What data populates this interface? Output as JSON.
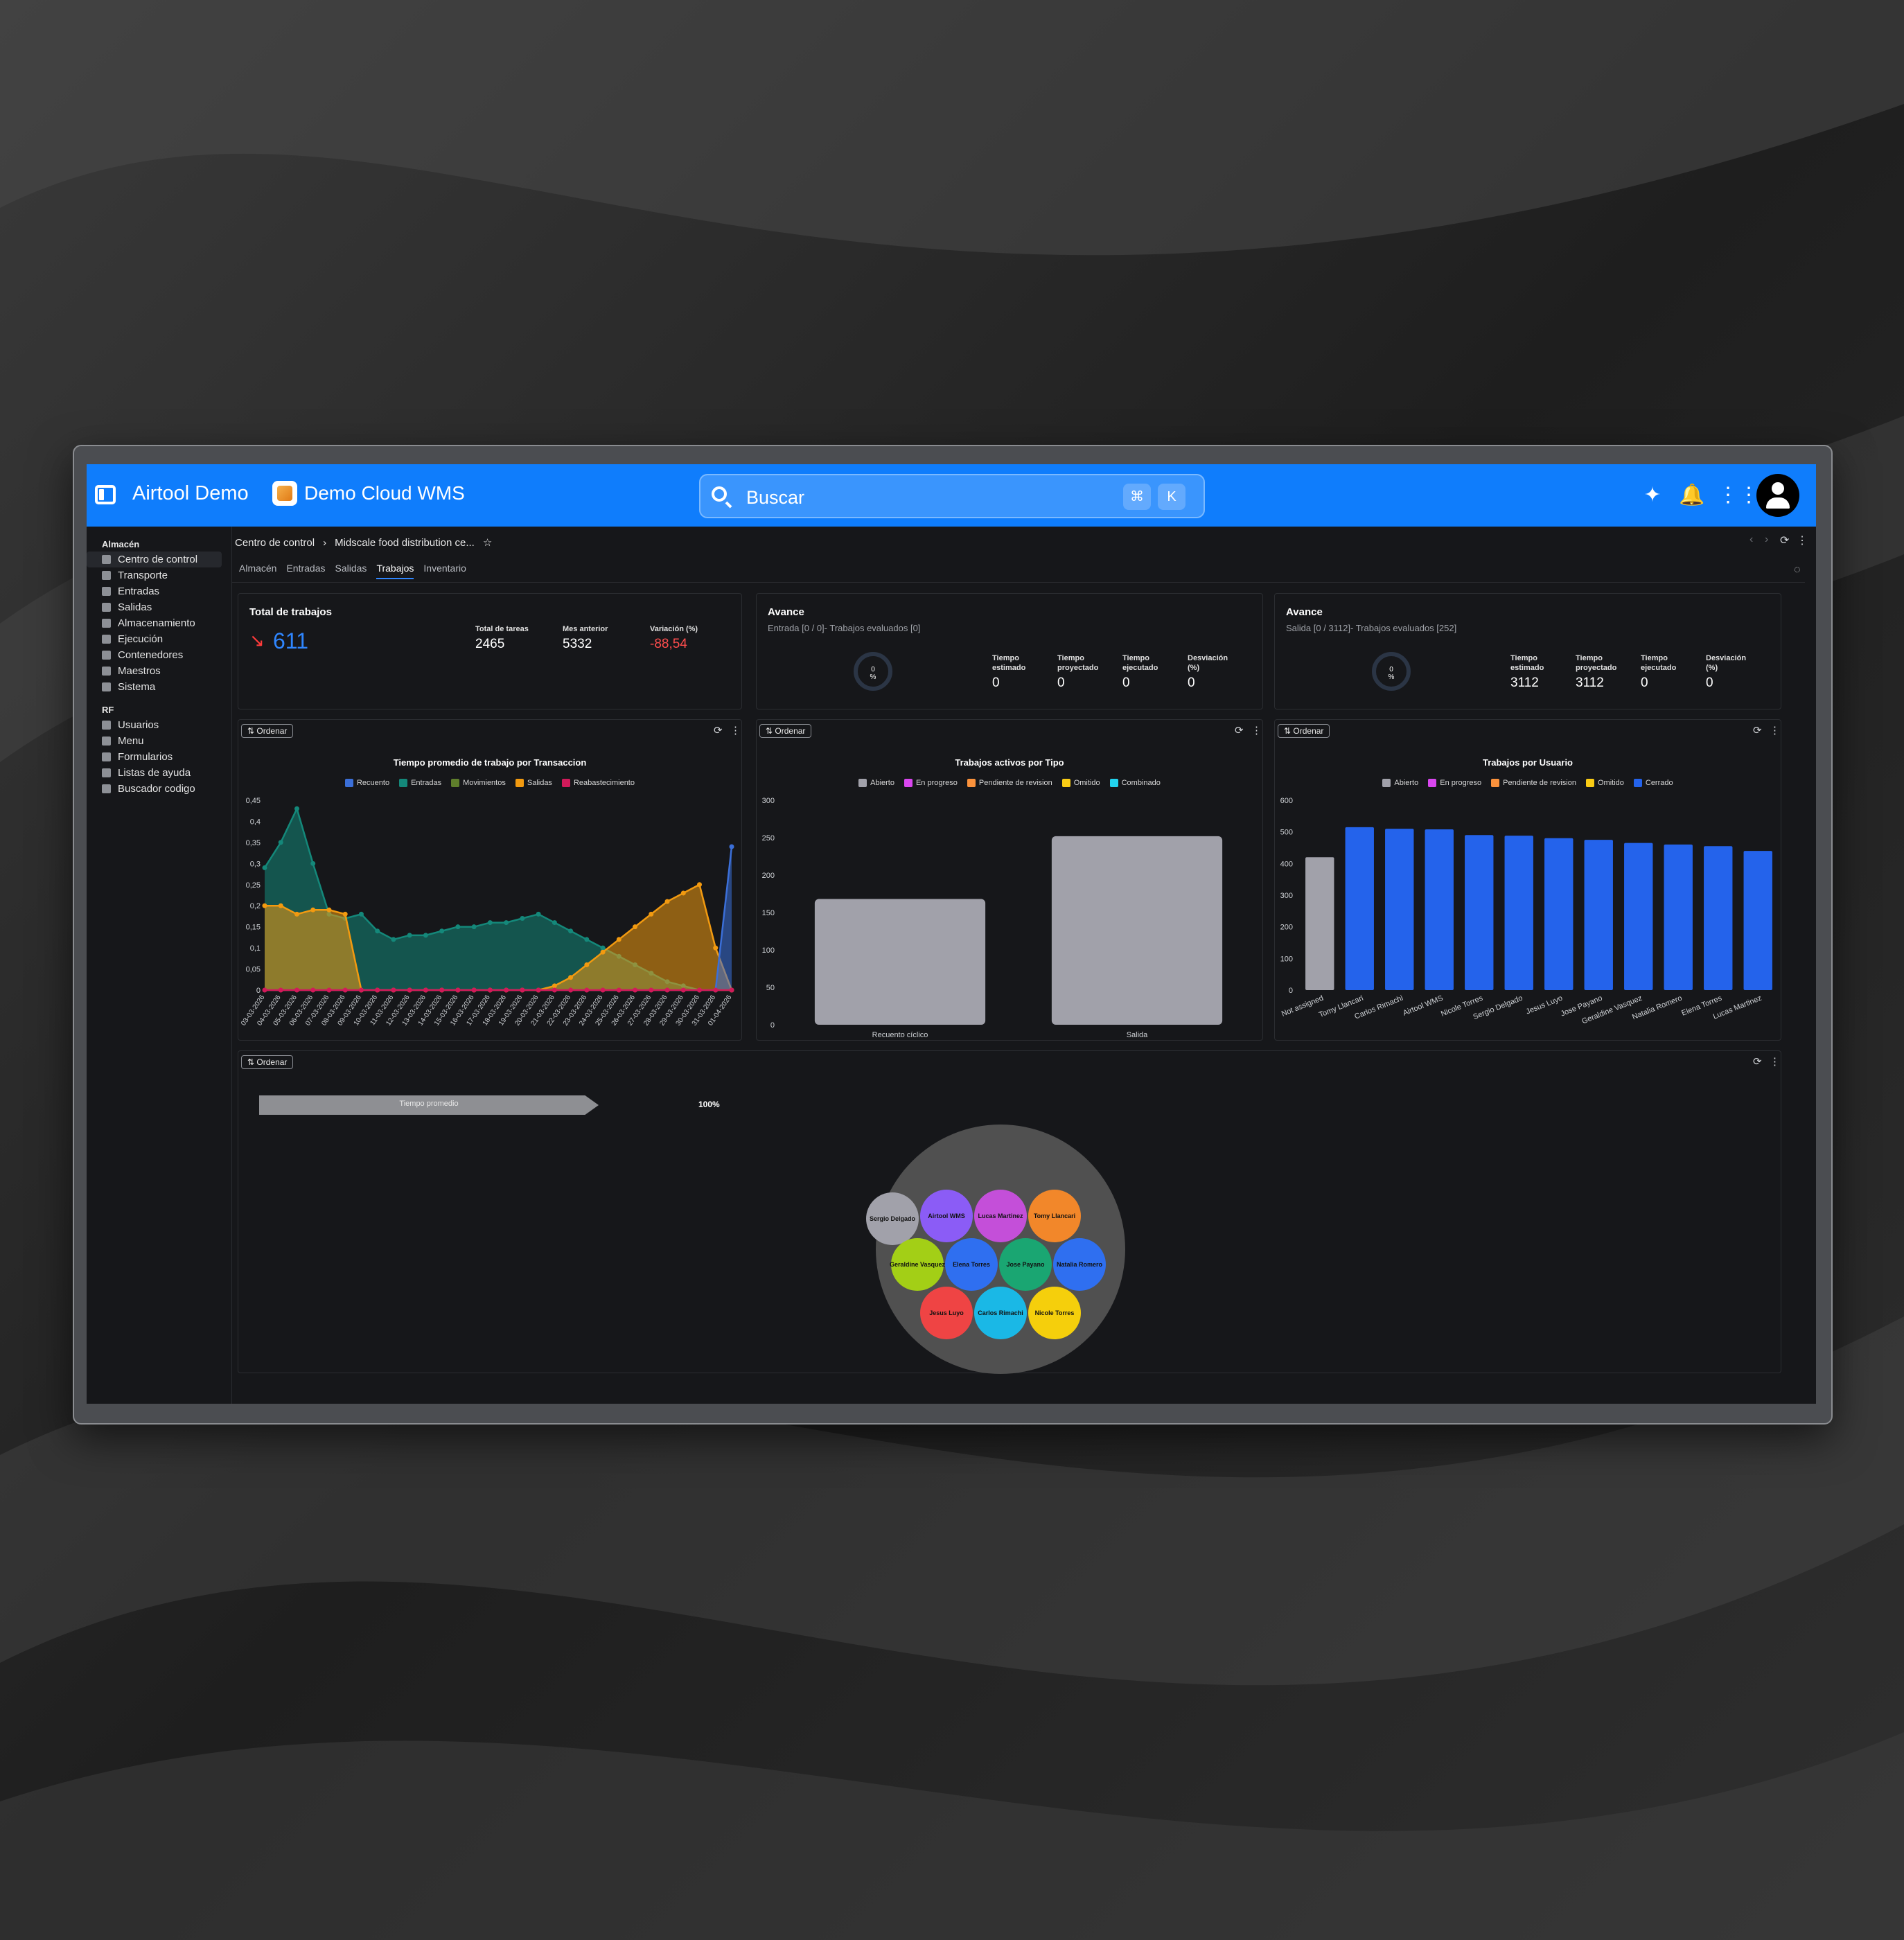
{
  "app": {
    "title": "Airtool Demo",
    "company": "Demo Cloud WMS"
  },
  "search": {
    "placeholder": "Buscar",
    "kbd1": "⌘",
    "kbd2": "K"
  },
  "sidebar": {
    "sections": [
      {
        "title": "Almacén",
        "items": [
          "Centro de control",
          "Transporte",
          "Entradas",
          "Salidas",
          "Almacenamiento",
          "Ejecución",
          "Contenedores",
          "Maestros",
          "Sistema"
        ]
      },
      {
        "title": "RF",
        "items": [
          "Usuarios",
          "Menu",
          "Formularios",
          "Listas de ayuda",
          "Buscador codigo"
        ]
      }
    ]
  },
  "breadcrumb": {
    "root": "Centro de control",
    "current": "Midscale food distribution ce..."
  },
  "tabs": [
    "Almacén",
    "Entradas",
    "Salidas",
    "Trabajos",
    "Inventario"
  ],
  "active_tab": "Trabajos",
  "kpi_total": {
    "title": "Total de trabajos",
    "value": "611",
    "stats": [
      {
        "label": "Total de tareas",
        "value": "2465"
      },
      {
        "label": "Mes anterior",
        "value": "5332"
      },
      {
        "label": "Variación (%)",
        "value": "-88,54"
      }
    ]
  },
  "avance_entrada": {
    "title": "Avance",
    "subtitle": "Entrada [0 / 0]- Trabajos evaluados [0]",
    "ring_value": "0",
    "ring_unit": "%",
    "stats": [
      {
        "label": "Tiempo estimado",
        "value": "0"
      },
      {
        "label": "Tiempo proyectado",
        "value": "0"
      },
      {
        "label": "Tiempo ejecutado",
        "value": "0"
      },
      {
        "label": "Desviación (%)",
        "value": "0"
      }
    ]
  },
  "avance_salida": {
    "title": "Avance",
    "subtitle": "Salida [0 / 3112]- Trabajos evaluados [252]",
    "ring_value": "0",
    "ring_unit": "%",
    "stats": [
      {
        "label": "Tiempo estimado",
        "value": "3112"
      },
      {
        "label": "Tiempo proyectado",
        "value": "3112"
      },
      {
        "label": "Tiempo ejecutado",
        "value": "0"
      },
      {
        "label": "Desviación (%)",
        "value": "0"
      }
    ]
  },
  "order_label": "Ordenar",
  "colors": {
    "accent": "#0f7dfc",
    "recuento": "#3b6fd8",
    "entradas": "#14887a",
    "movimientos": "#5f7f2c",
    "salidas": "#f29a10",
    "reabastecimiento": "#d11a5a",
    "gray": "#a1a1aa",
    "blue": "#2463eb"
  },
  "chart_data": [
    {
      "type": "area",
      "title": "Tiempo promedio de trabajo por Transaccion",
      "x": [
        "03-03-2026",
        "04-03-2026",
        "05-03-2026",
        "06-03-2026",
        "07-03-2026",
        "08-03-2026",
        "09-03-2026",
        "10-03-2026",
        "11-03-2026",
        "12-03-2026",
        "13-03-2026",
        "14-03-2026",
        "15-03-2026",
        "16-03-2026",
        "17-03-2026",
        "18-03-2026",
        "19-03-2026",
        "20-03-2026",
        "21-03-2026",
        "22-03-2026",
        "23-03-2026",
        "24-03-2026",
        "25-03-2026",
        "26-03-2026",
        "27-03-2026",
        "28-03-2026",
        "29-03-2026",
        "30-03-2026",
        "31-03-2026",
        "01-04-2026"
      ],
      "ylim": [
        0,
        0.45
      ],
      "yticks": [
        "0",
        "0,05",
        "0,1",
        "0,15",
        "0,2",
        "0,25",
        "0,3",
        "0,35",
        "0,4",
        "0,45"
      ],
      "series": [
        {
          "name": "Recuento",
          "values": [
            0,
            0,
            0,
            0,
            0,
            0,
            0,
            0,
            0,
            0,
            0,
            0,
            0,
            0,
            0,
            0,
            0,
            0,
            0,
            0,
            0,
            0,
            0,
            0,
            0,
            0,
            0,
            0,
            0,
            0.34
          ]
        },
        {
          "name": "Entradas",
          "values": [
            0.29,
            0.35,
            0.43,
            0.3,
            0.18,
            0.17,
            0.18,
            0.14,
            0.12,
            0.13,
            0.13,
            0.14,
            0.15,
            0.15,
            0.16,
            0.16,
            0.17,
            0.18,
            0.16,
            0.14,
            0.12,
            0.1,
            0.08,
            0.06,
            0.04,
            0.02,
            0.01,
            0,
            0,
            0
          ]
        },
        {
          "name": "Movimientos",
          "values": [
            0,
            0,
            0,
            0,
            0,
            0,
            0,
            0,
            0,
            0,
            0,
            0,
            0,
            0,
            0,
            0,
            0,
            0,
            0,
            0,
            0,
            0,
            0,
            0,
            0,
            0,
            0,
            0,
            0,
            0
          ]
        },
        {
          "name": "Salidas",
          "values": [
            0.2,
            0.2,
            0.18,
            0.19,
            0.19,
            0.18,
            0,
            0,
            0,
            0,
            0,
            0,
            0,
            0,
            0,
            0,
            0,
            0,
            0.01,
            0.03,
            0.06,
            0.09,
            0.12,
            0.15,
            0.18,
            0.21,
            0.23,
            0.25,
            0.1,
            0
          ]
        },
        {
          "name": "Reabastecimiento",
          "values": [
            0,
            0,
            0,
            0,
            0,
            0,
            0,
            0,
            0,
            0,
            0,
            0,
            0,
            0,
            0,
            0,
            0,
            0,
            0,
            0,
            0,
            0,
            0,
            0,
            0,
            0,
            0,
            0,
            0,
            0
          ]
        }
      ]
    },
    {
      "type": "bar",
      "title": "Trabajos activos por Tipo",
      "categories": [
        "Recuento cíclico",
        "Salida"
      ],
      "legend": [
        "Abierto",
        "En progreso",
        "Pendiente de revision",
        "Omitido",
        "Combinado"
      ],
      "ylim": [
        0,
        300
      ],
      "yticks": [
        "0",
        "50",
        "100",
        "150",
        "200",
        "250",
        "300"
      ],
      "series": [
        {
          "name": "Abierto",
          "values": [
            168,
            252
          ]
        }
      ]
    },
    {
      "type": "bar",
      "title": "Trabajos por Usuario",
      "categories": [
        "Not assigned",
        "Tomy Llancari",
        "Carlos Rimachi",
        "Airtool WMS",
        "Nicole Torres",
        "Sergio Delgado",
        "Jesus Luyo",
        "Jose Payano",
        "Geraldine Vasquez",
        "Natalia Romero",
        "Elena Torres",
        "Lucas Martinez"
      ],
      "legend": [
        "Abierto",
        "En progreso",
        "Pendiente de revision",
        "Omitido",
        "Cerrado"
      ],
      "ylim": [
        0,
        600
      ],
      "yticks": [
        "0",
        "100",
        "200",
        "300",
        "400",
        "500",
        "600"
      ],
      "series": [
        {
          "name": "Abierto",
          "values": [
            420,
            0,
            0,
            0,
            0,
            0,
            0,
            0,
            0,
            0,
            0,
            0
          ]
        },
        {
          "name": "Cerrado",
          "values": [
            0,
            515,
            510,
            508,
            490,
            488,
            480,
            475,
            465,
            460,
            455,
            440
          ]
        }
      ]
    }
  ],
  "funnel": {
    "label": "Tiempo promedio",
    "percent": "100%"
  },
  "bubbles": [
    "Sergio Delgado",
    "Airtool WMS",
    "Lucas Martinez",
    "Tomy Llancari",
    "Geraldine Vasquez",
    "Elena Torres",
    "Jose Payano",
    "Natalia Romero",
    "Jesus Luyo",
    "Carlos Rimachi",
    "Nicole Torres"
  ]
}
